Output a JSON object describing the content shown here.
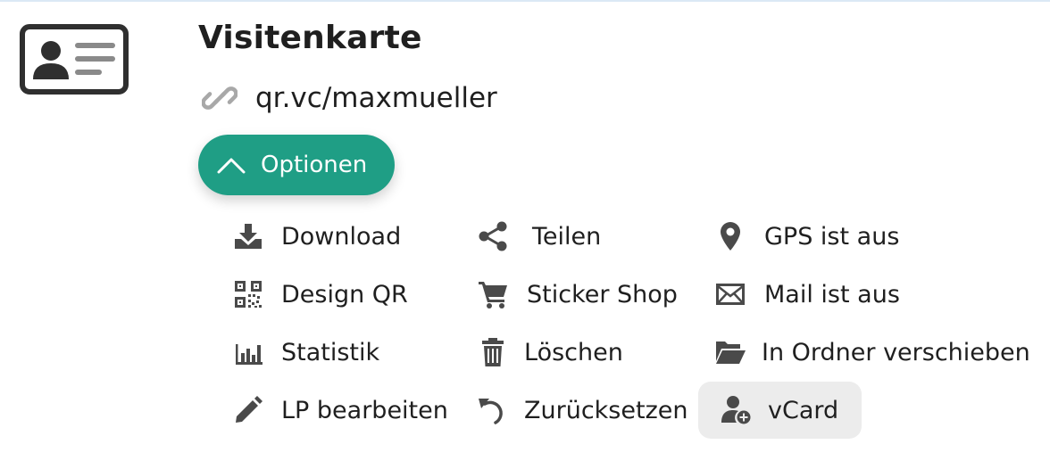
{
  "header": {
    "title": "Visitenkarte",
    "url": "qr.vc/maxmueller"
  },
  "options_button": {
    "label": "Optionen"
  },
  "menu": {
    "download": "Download",
    "design_qr": "Design QR",
    "statistik": "Statistik",
    "lp_bearbeiten": "LP bearbeiten",
    "teilen": "Teilen",
    "sticker_shop": "Sticker Shop",
    "loeschen": "Löschen",
    "zuruecksetzen": "Zurücksetzen",
    "gps": "GPS ist aus",
    "mail": "Mail ist aus",
    "ordner": "In Ordner verschieben",
    "vcard": "vCard"
  },
  "colors": {
    "accent": "#1f9e85",
    "text": "#1f1f1f",
    "icon": "#4a4a4a",
    "highlight": "#ececec"
  }
}
